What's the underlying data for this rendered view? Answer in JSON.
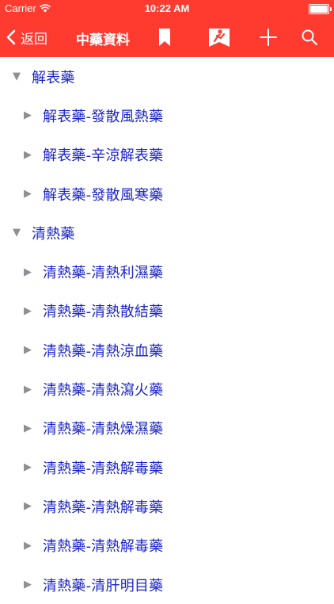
{
  "status_bar": {
    "carrier": "Carrier",
    "time": "10:22 AM"
  },
  "nav_bar": {
    "back_label": "返回",
    "title": "中藥資料",
    "icons": [
      "bookmark-icon",
      "reader-icon",
      "plus-icon",
      "search-icon"
    ]
  },
  "tree": [
    {
      "type": "category",
      "label": "解表藥"
    },
    {
      "type": "item",
      "label": "解表藥-發散風熱藥"
    },
    {
      "type": "item",
      "label": "解表藥-辛涼解表藥"
    },
    {
      "type": "item",
      "label": "解表藥-發散風寒藥"
    },
    {
      "type": "category",
      "label": "清熱藥"
    },
    {
      "type": "item",
      "label": "清熱藥-清熱利濕藥"
    },
    {
      "type": "item",
      "label": "清熱藥-清熱散結藥"
    },
    {
      "type": "item",
      "label": "清熱藥-清熱涼血藥"
    },
    {
      "type": "item",
      "label": "清熱藥-清熱瀉火藥"
    },
    {
      "type": "item",
      "label": "清熱藥-清熱燥濕藥"
    },
    {
      "type": "item",
      "label": "清熱藥-清熱解毒藥"
    },
    {
      "type": "item",
      "label": "清熱藥-清熱解毒藥"
    },
    {
      "type": "item",
      "label": "清熱藥-清熱解毒藥"
    },
    {
      "type": "item",
      "label": "清熱藥-清肝明目藥"
    }
  ],
  "colors": {
    "accent": "#ff3b30",
    "link_text": "#1a25c8",
    "disclosure": "#8e8e93"
  }
}
